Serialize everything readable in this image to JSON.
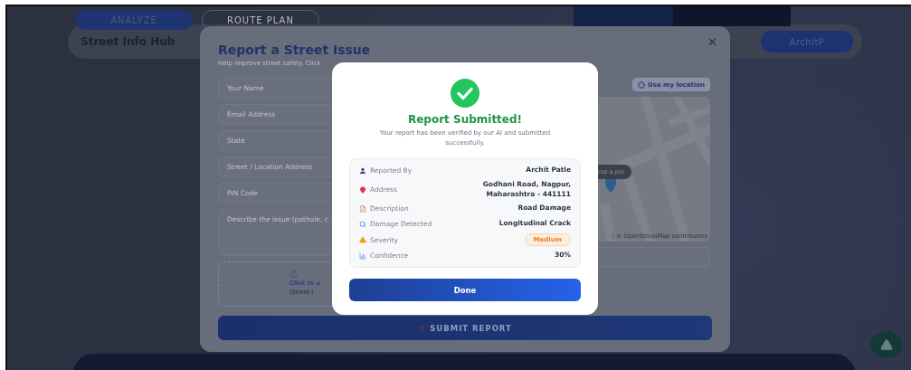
{
  "top_tabs": [
    {
      "label": "ANALYZE",
      "selected": true
    },
    {
      "label": "ROUTE PLAN",
      "selected": false
    }
  ],
  "header": {
    "title": "Street Info Hub",
    "user_button": "ArchitP"
  },
  "report_form": {
    "title": "Report a Street Issue",
    "subtitle": "Help improve street safety. Click",
    "close": "✕",
    "fields": [
      {
        "placeholder": "Your Name"
      },
      {
        "placeholder": "Email Address"
      },
      {
        "placeholder": "State"
      },
      {
        "placeholder": "Street / Location Address"
      },
      {
        "placeholder": "PIN Code"
      }
    ],
    "description_placeholder": "Describe the issue (pothole, c",
    "upload": {
      "line_1": "Click to u",
      "line_2": "(Street i"
    },
    "location_button": "Use my location",
    "map": {
      "tooltip": "rop a pin",
      "attribution": "| © OpenStreetMap contributors"
    },
    "submit_button": "SUBMIT REPORT"
  },
  "success_dialog": {
    "title": "Report Submitted!",
    "message": "Your report has been verified by our AI and submitted successfully.",
    "details": [
      {
        "kind": "person",
        "label": "Reported By",
        "value": "Archit Patle"
      },
      {
        "kind": "pin",
        "label": "Address",
        "value": "Godhani Road, Nagpur, Maharashtra - 441111"
      },
      {
        "kind": "memo",
        "label": "Description",
        "value": "Road Damage"
      },
      {
        "kind": "search",
        "label": "Damage Detected",
        "value": "Longitudinal Crack"
      },
      {
        "kind": "warning",
        "label": "Severity",
        "value": "Medium",
        "badge": true
      },
      {
        "kind": "chart",
        "label": "Confidence",
        "value": "30%"
      }
    ],
    "done_button": "Done"
  }
}
